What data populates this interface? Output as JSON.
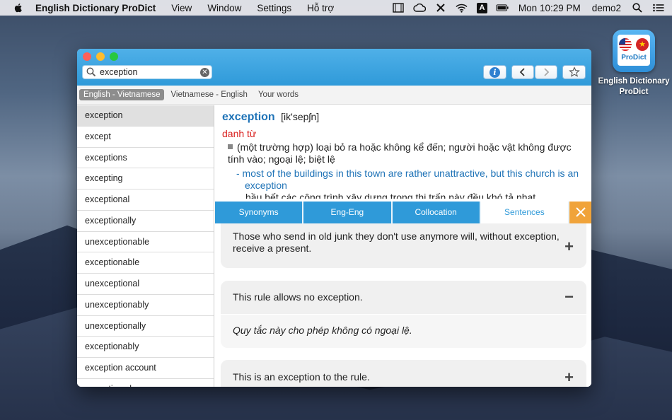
{
  "menubar": {
    "app_name": "English Dictionary ProDict",
    "menus": [
      "View",
      "Window",
      "Settings",
      "Hỗ trợ"
    ],
    "clock": "Mon 10:29 PM",
    "user": "demo2",
    "input_source": "A"
  },
  "desktop_icon": {
    "badge": "ProDict",
    "label_line1": "English Dictionary",
    "label_line2": "ProDict"
  },
  "search": {
    "value": "exception"
  },
  "language_tabs": [
    "English - Vietnamese",
    "Vietnamese - English",
    "Your words"
  ],
  "word_list": [
    "exception",
    "except",
    "exceptions",
    "excepting",
    "exceptional",
    "exceptionally",
    "unexceptionable",
    "exceptionable",
    "unexceptional",
    "unexceptionably",
    "unexceptionally",
    "exceptionably",
    "exception account",
    "exception clause"
  ],
  "definition": {
    "headword": "exception",
    "phonetic": "[ik'sepʃn]",
    "part_of_speech": "danh từ",
    "meaning": "(một trường hợp) loại bỏ ra hoặc không kể đến; người hoặc vật không được tính vào; ngoại lệ; biệt lệ",
    "example_en": "-  most of the buildings in this town are rather unattractive, but this church is an exception",
    "example_vi": "hầu hết các công trình xây dựng trong thị trấn này đều khó tả nhạt"
  },
  "detail_tabs": [
    "Synonyms",
    "Eng-Eng",
    "Collocation",
    "Sentences"
  ],
  "sentences": [
    {
      "en": "Those who send in old junk they don't use anymore will, without exception, receive a present.",
      "toggle": "+"
    },
    {
      "en": "This rule allows no exception.",
      "vi": "Quy tắc này cho phép không có ngoại lệ.",
      "toggle": "−"
    },
    {
      "en": "This is an exception to the rule.",
      "toggle": "+"
    }
  ],
  "colors": {
    "accent": "#2f9ad9",
    "headword": "#1f73b7",
    "part_of_speech": "#d9201e",
    "close_tab": "#f0a33a"
  }
}
